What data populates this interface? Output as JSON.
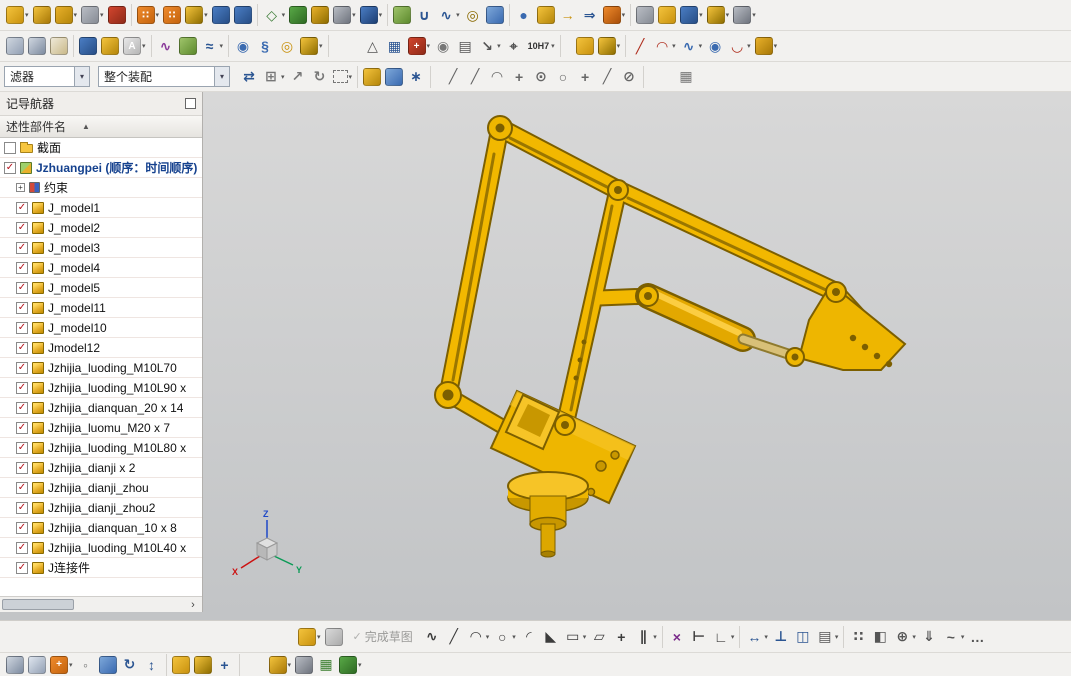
{
  "colors": {
    "viewport_top": "#d8d8d8",
    "viewport_bottom": "#c2c4c6",
    "check_red": "#b5121b",
    "model_yellow": "#f2b800",
    "model_fill": "#eeb600",
    "model_bright": "#f6c427",
    "model_shade": "#c89700",
    "model_outline": "#7c5f00",
    "model_slot": "#9a7600",
    "model_highlight": "#ffd34d",
    "model_rod": "#d8c078",
    "model_rod_dark": "#8f7a2e"
  },
  "glyphs": {
    "caret": "▾",
    "check": "✓",
    "sort": "▲",
    "scroll_arrow": "›",
    "expander_plus": "+"
  },
  "toolbar_row1": {
    "icons": [
      {
        "n": "block-feature-icon",
        "c1": "#f3c33c",
        "c2": "#c9920f",
        "a": 1
      },
      {
        "n": "cylinder-feature-icon",
        "c1": "#f3c33c",
        "c2": "#a87807"
      },
      {
        "n": "boss-feature-icon",
        "c1": "#e8b02a",
        "c2": "#b5860a",
        "a": 1
      },
      {
        "n": "revolve-icon",
        "c1": "#b9bdc4",
        "c2": "#878c95",
        "a": 1
      },
      {
        "n": "hole-feature-icon",
        "c1": "#d2452e",
        "c2": "#8f2a18",
        "s": 1
      },
      {
        "n": "pattern-feature-icon",
        "g": "∷",
        "c1": "#ef8a2c",
        "c2": "#c4640e",
        "a": 1
      },
      {
        "n": "mirror-feature-icon",
        "g": "∷",
        "c1": "#ef8a2c",
        "c2": "#c4640e"
      },
      {
        "n": "unite-icon",
        "c1": "#f3c33c",
        "c2": "#8f6e00",
        "a": 1
      },
      {
        "n": "subtract-icon",
        "c1": "#4a7dc4",
        "c2": "#274e86"
      },
      {
        "n": "intersect-icon",
        "c1": "#4a7dc4",
        "c2": "#274e86",
        "s": 1
      },
      {
        "n": "datum-plane-icon",
        "f": 1,
        "g": "◇",
        "c1": "#3f7e3a",
        "a": 1
      },
      {
        "n": "trim-body-icon",
        "c1": "#58a846",
        "c2": "#2f6b24"
      },
      {
        "n": "shell-icon",
        "c1": "#e8b02a",
        "c2": "#8f6e00"
      },
      {
        "n": "draft-icon",
        "c1": "#b9bdc4",
        "c2": "#6f747e",
        "a": 1
      },
      {
        "n": "edge-blend-icon",
        "c1": "#4a7dc4",
        "c2": "#1d3f73",
        "a": 1,
        "s": 1
      },
      {
        "n": "chamfer-icon",
        "c1": "#9fc46a",
        "c2": "#5d8a2e"
      },
      {
        "n": "through-curves-icon",
        "f": 1,
        "g": "∪",
        "c1": "#2b5592"
      },
      {
        "n": "swept-icon",
        "f": 1,
        "g": "∿",
        "c1": "#2b5592",
        "a": 1
      },
      {
        "n": "tube-icon",
        "f": 1,
        "g": "◎",
        "c1": "#8a6a00"
      },
      {
        "n": "bounded-plane-icon",
        "c1": "#7da7d9",
        "c2": "#3a6ab0",
        "s": 1
      },
      {
        "n": "sphere-icon",
        "f": 1,
        "g": "●",
        "c1": "#3a6ab0"
      },
      {
        "n": "cube-corner-icon",
        "c1": "#f3c33c",
        "c2": "#b5860a"
      },
      {
        "n": "move-face-icon",
        "f": 1,
        "g": "→",
        "c1": "#c9920f"
      },
      {
        "n": "offset-face-icon",
        "f": 1,
        "g": "⇒",
        "c1": "#2b5592"
      },
      {
        "n": "synchronous-modeling-icon",
        "c1": "#ef8a2c",
        "c2": "#a84e08",
        "a": 1,
        "s": 1
      },
      {
        "n": "measure-icon",
        "c1": "#b9bdc4",
        "c2": "#878c95"
      },
      {
        "n": "assembly-icon",
        "c1": "#f3c33c",
        "c2": "#c9920f"
      },
      {
        "n": "component-pattern-icon",
        "c1": "#4a7dc4",
        "c2": "#274e86",
        "a": 1
      },
      {
        "n": "move-component-icon",
        "c1": "#f3c33c",
        "c2": "#8f6e00",
        "a": 1
      },
      {
        "n": "exploded-view-icon",
        "c1": "#b9bdc4",
        "c2": "#6f747e",
        "a": 1
      }
    ]
  },
  "toolbar_row2": {
    "icons": [
      {
        "n": "sheet-stack-icon",
        "c1": "#cfd6df",
        "c2": "#93a0b4"
      },
      {
        "n": "book-icon",
        "c1": "#cfd6df",
        "c2": "#7e8ca1"
      },
      {
        "n": "note-sheet-icon",
        "c1": "#efe9d8",
        "c2": "#c9b98a",
        "s": 1
      },
      {
        "n": "measure-body-icon",
        "c1": "#4a7dc4",
        "c2": "#274e86"
      },
      {
        "n": "edit-object-icon",
        "c1": "#f3c33c",
        "c2": "#b5860a"
      },
      {
        "n": "spell-check-icon",
        "g": "A",
        "c1": "#e8e8e8",
        "c2": "#b5b5b5",
        "a": 1,
        "s": 1
      },
      {
        "n": "curve-analysis-icon",
        "f": 1,
        "g": "∿",
        "c1": "#8a3a9a"
      },
      {
        "n": "face-analysis-icon",
        "c1": "#9fc46a",
        "c2": "#5d8a2e"
      },
      {
        "n": "deviation-icon",
        "f": 1,
        "g": "≈",
        "c1": "#2b5592",
        "a": 1,
        "s": 1
      },
      {
        "n": "spiral-icon",
        "f": 1,
        "g": "◉",
        "c1": "#3a6ab0"
      },
      {
        "n": "spring-icon",
        "f": 1,
        "g": "§",
        "c1": "#3a6ab0"
      },
      {
        "n": "torus-icon",
        "f": 1,
        "g": "◎",
        "c1": "#c9920f"
      },
      {
        "n": "emboss-icon",
        "c1": "#f3c33c",
        "c2": "#8f6e00",
        "a": 1,
        "s": 1
      },
      {
        "n": "draft-analysis-icon",
        "f": 1,
        "g": "△",
        "c1": "#555555",
        "gap": 30
      },
      {
        "n": "grid-table-icon",
        "f": 1,
        "g": "▦",
        "c1": "#2b5592"
      },
      {
        "n": "pattern-annotation-icon",
        "g": "+",
        "c1": "#d2452e",
        "c2": "#8f2a18",
        "a": 1
      },
      {
        "n": "id-symbol-icon",
        "f": 1,
        "g": "◉",
        "c1": "#777777"
      },
      {
        "n": "note-icon",
        "f": 1,
        "g": "▤",
        "c1": "#555555"
      },
      {
        "n": "leader-icon",
        "f": 1,
        "g": "↘",
        "c1": "#555555",
        "a": 1
      },
      {
        "n": "datum-feature-symbol-icon",
        "f": 1,
        "g": "⌖",
        "c1": "#555555"
      },
      {
        "n": "tolerance-icon",
        "label": "10H7",
        "c1": "#333333",
        "a": 1,
        "s": 1
      },
      {
        "n": "move-object-icon",
        "c1": "#f3c33c",
        "c2": "#c9920f",
        "gap": 10
      },
      {
        "n": "assembly-arrangements-icon",
        "c1": "#f3c33c",
        "c2": "#8f6e00",
        "a": 1,
        "s": 1
      },
      {
        "n": "line-curve-icon",
        "f": 1,
        "g": "╱",
        "c1": "#b03020"
      },
      {
        "n": "arc-curve-icon",
        "f": 1,
        "g": "◠",
        "c1": "#b03020",
        "a": 1
      },
      {
        "n": "studio-spline-icon",
        "f": 1,
        "g": "∿",
        "c1": "#3a6ab0",
        "a": 1
      },
      {
        "n": "helix-curve-icon",
        "f": 1,
        "g": "◉",
        "c1": "#3a6ab0"
      },
      {
        "n": "more-curves-icon",
        "f": 1,
        "g": "◡",
        "c1": "#b03020",
        "a": 1
      },
      {
        "n": "surface-icon",
        "c1": "#e8b02a",
        "c2": "#a87807",
        "a": 1
      }
    ]
  },
  "toolbar_row3": {
    "filter_value": "滤器",
    "scope_value": "整个装配",
    "icons": [
      {
        "n": "interpart-link-icon",
        "f": 1,
        "g": "⇄",
        "c1": "#2b5592"
      },
      {
        "n": "plus-box-icon",
        "f": 1,
        "g": "⊞",
        "c1": "#777777",
        "a": 1
      },
      {
        "n": "snap-arrow-icon",
        "f": 1,
        "g": "↗",
        "c1": "#777777"
      },
      {
        "n": "rotate-handle-icon",
        "f": 1,
        "g": "↻",
        "c1": "#777777"
      },
      {
        "n": "marquee-select-icon",
        "f": 1,
        "dashed": 1,
        "g": "",
        "c1": "#555555",
        "a": 1,
        "s": 1
      },
      {
        "n": "solid-body-filter-icon",
        "c1": "#f3c33c",
        "c2": "#b5860a"
      },
      {
        "n": "facet-body-filter-icon",
        "c1": "#7da7d9",
        "c2": "#3a6ab0"
      },
      {
        "n": "point-pattern-icon",
        "f": 1,
        "g": "∗",
        "c1": "#2b5592",
        "s": 1
      },
      {
        "n": "snap-endpoint-icon",
        "f": 1,
        "g": "╱",
        "c1": "#666666",
        "gap": 8
      },
      {
        "n": "snap-midpoint-icon",
        "f": 1,
        "g": "╱",
        "c1": "#666666"
      },
      {
        "n": "snap-arc-icon",
        "f": 1,
        "g": "◠",
        "c1": "#666666"
      },
      {
        "n": "snap-intersection-icon",
        "f": 1,
        "g": "+",
        "c1": "#666666"
      },
      {
        "n": "snap-center-icon",
        "f": 1,
        "g": "⊙",
        "c1": "#666666"
      },
      {
        "n": "snap-quadrant-icon",
        "f": 1,
        "g": "○",
        "c1": "#666666"
      },
      {
        "n": "snap-existing-point-icon",
        "f": 1,
        "g": "+",
        "c1": "#666666"
      },
      {
        "n": "snap-point-on-curve-icon",
        "f": 1,
        "g": "╱",
        "c1": "#666666"
      },
      {
        "n": "snap-point-on-surface-icon",
        "f": 1,
        "g": "⊘",
        "c1": "#666666",
        "s": 1
      },
      {
        "n": "grid-snap-icon",
        "f": 1,
        "g": "▦",
        "c1": "#777777",
        "gap": 28
      }
    ]
  },
  "navigator": {
    "title": "记导航器",
    "column_header": "述性部件名",
    "tree": [
      {
        "label": "截面",
        "icon": "folder",
        "checkbox": "unchecked",
        "indent": 0
      },
      {
        "label": "Jzhuangpei (顺序：时间顺序)",
        "icon": "assembly",
        "checkbox": "checked",
        "indent": 0,
        "bold": true
      },
      {
        "label": "约束",
        "icon": "constraints",
        "checkbox": "none",
        "indent": 1,
        "expander": "+"
      },
      {
        "label": "J_model1",
        "icon": "part",
        "checkbox": "checked",
        "indent": 1
      },
      {
        "label": "J_model2",
        "icon": "part",
        "checkbox": "checked",
        "indent": 1
      },
      {
        "label": "J_model3",
        "icon": "part",
        "checkbox": "checked",
        "indent": 1
      },
      {
        "label": "J_model4",
        "icon": "part",
        "checkbox": "checked",
        "indent": 1
      },
      {
        "label": "J_model5",
        "icon": "part",
        "checkbox": "checked",
        "indent": 1
      },
      {
        "label": "J_model11",
        "icon": "part",
        "checkbox": "checked",
        "indent": 1
      },
      {
        "label": "J_model10",
        "icon": "part",
        "checkbox": "checked",
        "indent": 1
      },
      {
        "label": "Jmodel12",
        "icon": "part",
        "checkbox": "checked",
        "indent": 1
      },
      {
        "label": "Jzhijia_luoding_M10L70",
        "icon": "part",
        "checkbox": "checked",
        "indent": 1
      },
      {
        "label": "Jzhijia_luoding_M10L90 x",
        "icon": "part",
        "checkbox": "checked",
        "indent": 1
      },
      {
        "label": "Jzhijia_dianquan_20 x 14",
        "icon": "part",
        "checkbox": "checked",
        "indent": 1
      },
      {
        "label": "Jzhijia_luomu_M20 x 7",
        "icon": "part",
        "checkbox": "checked",
        "indent": 1
      },
      {
        "label": "Jzhijia_luoding_M10L80 x",
        "icon": "part",
        "checkbox": "checked",
        "indent": 1
      },
      {
        "label": "Jzhijia_dianji x 2",
        "icon": "part",
        "checkbox": "checked",
        "indent": 1
      },
      {
        "label": "Jzhijia_dianji_zhou",
        "icon": "part",
        "checkbox": "checked",
        "indent": 1
      },
      {
        "label": "Jzhijia_dianji_zhou2",
        "icon": "part",
        "checkbox": "checked",
        "indent": 1
      },
      {
        "label": "Jzhijia_dianquan_10 x 8",
        "icon": "part",
        "checkbox": "checked",
        "indent": 1
      },
      {
        "label": "Jzhijia_luoding_M10L40 x",
        "icon": "part",
        "checkbox": "checked",
        "indent": 1
      },
      {
        "label": "J连接件",
        "icon": "part",
        "checkbox": "checked",
        "indent": 1
      }
    ]
  },
  "viewport": {
    "triad": {
      "x": "X",
      "y": "Y",
      "z": "Z"
    }
  },
  "sketch_toolbar": {
    "finish_label": "完成草图",
    "icons_pre": [
      {
        "n": "sketch-icon",
        "c1": "#f3c33c",
        "c2": "#c9920f",
        "a": 1
      },
      {
        "n": "orient-sketch-icon",
        "c1": "#d9d9d9",
        "c2": "#ababab"
      }
    ],
    "icons_post": [
      {
        "n": "profile-icon",
        "f": 1,
        "g": "∿",
        "c1": "#3c3c3c"
      },
      {
        "n": "line-icon",
        "f": 1,
        "g": "╱",
        "c1": "#3c3c3c"
      },
      {
        "n": "arc-icon",
        "f": 1,
        "g": "◠",
        "c1": "#3c3c3c",
        "a": 1
      },
      {
        "n": "circle-icon",
        "f": 1,
        "g": "○",
        "c1": "#3c3c3c",
        "a": 1
      },
      {
        "n": "fillet-icon",
        "f": 1,
        "g": "◜",
        "c1": "#3c3c3c"
      },
      {
        "n": "chamfer-icon",
        "f": 1,
        "g": "◣",
        "c1": "#3c3c3c"
      },
      {
        "n": "rectangle-icon",
        "f": 1,
        "g": "▭",
        "c1": "#3c3c3c",
        "a": 1
      },
      {
        "n": "polygon-icon",
        "f": 1,
        "g": "▱",
        "c1": "#3c3c3c"
      },
      {
        "n": "point-icon",
        "f": 1,
        "g": "+",
        "c1": "#3c3c3c"
      },
      {
        "n": "offset-curve-icon",
        "f": 1,
        "g": "∥",
        "c1": "#3c3c3c",
        "a": 1,
        "s": 1
      },
      {
        "n": "quick-trim-icon",
        "f": 1,
        "g": "×",
        "c1": "#7a2a8a"
      },
      {
        "n": "quick-extend-icon",
        "f": 1,
        "g": "⊢",
        "c1": "#3c3c3c"
      },
      {
        "n": "make-corner-icon",
        "f": 1,
        "g": "∟",
        "c1": "#3c3c3c",
        "a": 1,
        "s": 1
      },
      {
        "n": "rapid-dimension-icon",
        "f": 1,
        "g": "↔",
        "c1": "#2b5592",
        "a": 1
      },
      {
        "n": "geometric-constraints-icon",
        "f": 1,
        "g": "⊥",
        "c1": "#2b5592"
      },
      {
        "n": "make-symmetric-icon",
        "f": 1,
        "g": "◫",
        "c1": "#2b5592"
      },
      {
        "n": "display-constraints-icon",
        "f": 1,
        "g": "▤",
        "c1": "#555555",
        "a": 1,
        "s": 1
      },
      {
        "n": "pattern-curve-icon",
        "f": 1,
        "g": "∷",
        "c1": "#555555"
      },
      {
        "n": "mirror-curve-icon",
        "f": 1,
        "g": "◧",
        "c1": "#555555"
      },
      {
        "n": "intersection-point-icon",
        "f": 1,
        "g": "⊕",
        "c1": "#555555",
        "a": 1
      },
      {
        "n": "project-curve-icon",
        "f": 1,
        "g": "⇓",
        "c1": "#555555"
      },
      {
        "n": "edit-curve-icon",
        "f": 1,
        "g": "~",
        "c1": "#555555",
        "a": 1
      },
      {
        "n": "sketch-more-icon",
        "f": 1,
        "g": "…",
        "c1": "#555555"
      }
    ]
  },
  "bottom_toolbar": {
    "icons": [
      {
        "n": "part-database-icon",
        "c1": "#cfd6df",
        "c2": "#7e8ca1"
      },
      {
        "n": "window-icon",
        "c1": "#dfe6ef",
        "c2": "#93a0b4"
      },
      {
        "n": "add-user-icon",
        "g": "+",
        "c1": "#ef8a2c",
        "c2": "#c4640e",
        "a": 1
      },
      {
        "n": "pin-icon",
        "f": 1,
        "g": "◦",
        "c1": "#777777"
      },
      {
        "n": "external-window-icon",
        "c1": "#7da7d9",
        "c2": "#3a6ab0"
      },
      {
        "n": "refresh-icon",
        "f": 1,
        "g": "↻",
        "c1": "#2b5592"
      },
      {
        "n": "up-down-icon",
        "f": 1,
        "g": "↕",
        "c1": "#2b5592",
        "s": 1
      },
      {
        "n": "component-group-icon",
        "c1": "#f3c33c",
        "c2": "#c9920f"
      },
      {
        "n": "import-component-icon",
        "c1": "#f3c33c",
        "c2": "#8f6e00"
      },
      {
        "n": "add-component-icon",
        "f": 1,
        "g": "+",
        "c1": "#2b5592",
        "s": 1
      },
      {
        "n": "cylinder-tool-icon",
        "c1": "#f3c33c",
        "c2": "#a87807",
        "a": 1,
        "gap": 24
      },
      {
        "n": "clamp-icon",
        "c1": "#b9bdc4",
        "c2": "#6f747e"
      },
      {
        "n": "spreadsheet-icon",
        "f": 1,
        "g": "▦",
        "c1": "#3a7d2e"
      },
      {
        "n": "database-add-icon",
        "c1": "#58a846",
        "c2": "#2f6b24",
        "a": 1
      }
    ]
  }
}
